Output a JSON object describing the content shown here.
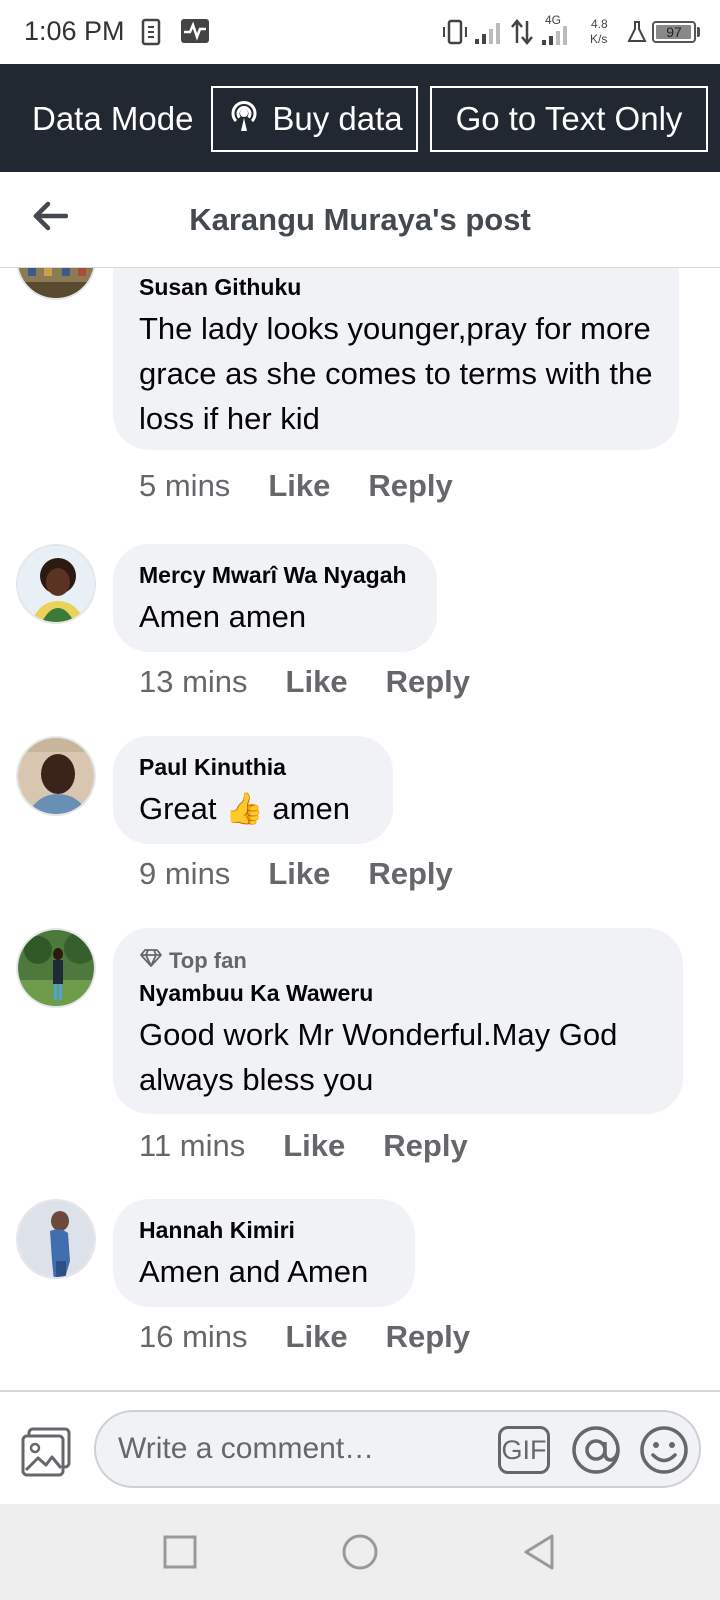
{
  "status_bar": {
    "time": "1:06 PM",
    "network_type": "4G",
    "speed_value": "4.8",
    "speed_unit": "K/s",
    "battery": "97",
    "battery_level": 0.97
  },
  "data_bar": {
    "mode_label": "Data Mode",
    "buy_data_label": "Buy data",
    "text_only_label": "Go to Text Only"
  },
  "header": {
    "title": "Karangu Muraya's post"
  },
  "comments": [
    {
      "author": "Susan Githuku",
      "text": "The lady looks younger,pray for more grace as she comes to terms with the loss if her kid",
      "time": "5 mins",
      "like": "Like",
      "reply": "Reply"
    },
    {
      "author": "Mercy Mwarî Wa Nyagah",
      "text": "Amen amen",
      "time": "13 mins",
      "like": "Like",
      "reply": "Reply"
    },
    {
      "author": "Paul Kinuthia",
      "text_before": "Great",
      "emoji": "👍",
      "text_after": "amen",
      "time": "9 mins",
      "like": "Like",
      "reply": "Reply"
    },
    {
      "badge": "Top fan",
      "author": "Nyambuu Ka Waweru",
      "text": "Good work Mr Wonderful.May God always bless you",
      "time": "11 mins",
      "like": "Like",
      "reply": "Reply"
    },
    {
      "author": "Hannah Kimiri",
      "text": "Amen and Amen",
      "time": "16 mins",
      "like": "Like",
      "reply": "Reply"
    }
  ],
  "composer": {
    "placeholder": "Write a comment…",
    "gif_label": "GIF"
  },
  "colors": {
    "data_bar_bg": "#222831",
    "bubble_bg": "#f0f2f5",
    "meta_text": "#65676b"
  }
}
